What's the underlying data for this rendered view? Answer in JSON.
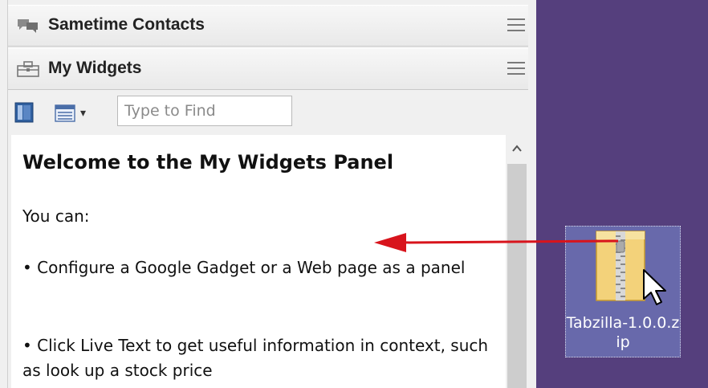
{
  "panel": {
    "sametime": {
      "title": "Sametime Contacts",
      "icon": "chat-bubbles-icon"
    },
    "widgets": {
      "title": "My Widgets",
      "icon": "toolbox-icon"
    },
    "toolbar": {
      "layout_icon": "panel-layout-icon",
      "view_icon": "view-list-icon",
      "dropdown_glyph": "▾",
      "find_placeholder": "Type to Find"
    },
    "content": {
      "title": "Welcome to the My Widgets Panel",
      "intro": "You can:",
      "bullet1": "• Configure a Google Gadget or a Web page as a panel",
      "bullet2": "• Click Live Text to get useful information in context, such as look up a stock price"
    }
  },
  "desktop": {
    "file": {
      "name": "Tabzilla-1.0.0.zip",
      "icon": "zip-folder-icon"
    }
  },
  "colors": {
    "desktop_bg": "#553f7d",
    "arrow": "#d8141c",
    "selection": "#7a8cd2"
  }
}
